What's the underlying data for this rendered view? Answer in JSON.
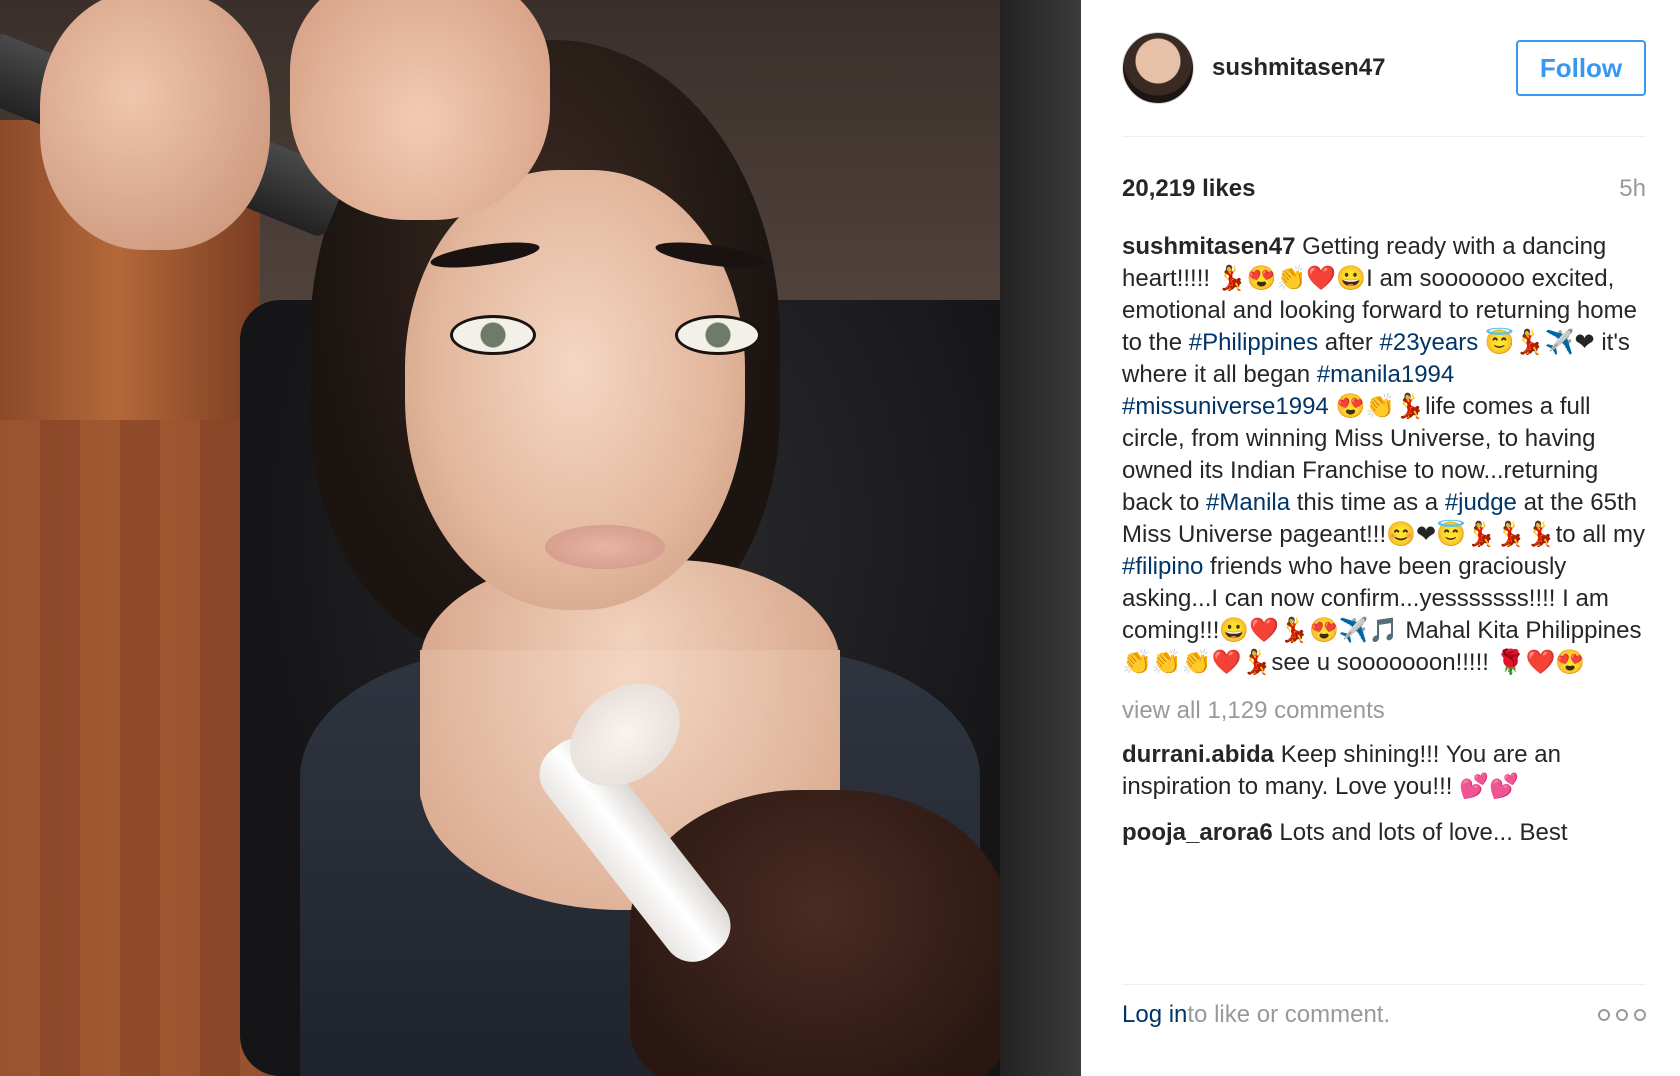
{
  "post": {
    "username": "sushmitasen47",
    "follow_label": "Follow",
    "likes": "20,219 likes",
    "time": "5h",
    "caption": {
      "username": "sushmitasen47",
      "parts": [
        {
          "text": " Getting ready with a dancing heart!!!!! 💃😍👏❤️😀I am sooooooo excited, emotional and looking forward to returning home to the "
        },
        {
          "tag": "#Philippines"
        },
        {
          "text": " after "
        },
        {
          "tag": "#23years"
        },
        {
          "text": " 😇💃✈️❤ it's where it all began "
        },
        {
          "tag": "#manila1994"
        },
        {
          "text": " "
        },
        {
          "tag": "#missuniverse1994"
        },
        {
          "text": " 😍👏💃life comes a full circle, from winning Miss Universe, to having owned its Indian Franchise to now...returning back to "
        },
        {
          "tag": "#Manila"
        },
        {
          "text": " this time as a "
        },
        {
          "tag": "#judge"
        },
        {
          "text": " at the 65th Miss Universe pageant!!!😊❤😇💃💃💃to all my "
        },
        {
          "tag": "#filipino"
        },
        {
          "text": " friends who have been graciously asking...I can now confirm...yesssssss!!!! I am coming!!!😀❤️💃😍✈️🎵 Mahal Kita Philippines 👏👏👏❤️💃see u sooooooon!!!!! 🌹❤️😍"
        }
      ]
    },
    "view_all": "view all 1,129 comments",
    "comments": [
      {
        "username": "durrani.abida",
        "text": " Keep shining!!! You are an inspiration to many. Love you!!! 💕💕"
      },
      {
        "username": "pooja_arora6",
        "text": " Lots and lots of love... Best"
      }
    ],
    "footer": {
      "login": "Log in",
      "rest": " to like or comment."
    }
  },
  "colors": {
    "accent": "#3897f0",
    "hashtag": "#003569",
    "muted": "#999999"
  },
  "icons": {
    "more": "more-dots-icon"
  }
}
